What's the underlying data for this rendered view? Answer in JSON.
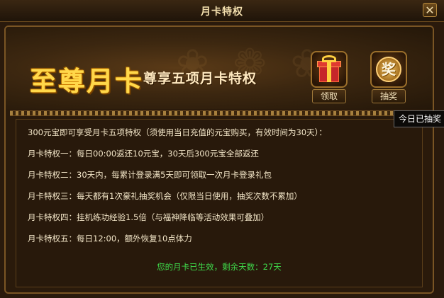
{
  "window": {
    "title": "月卡特权",
    "close_icon": "close-icon"
  },
  "banner": {
    "brand": "至尊月卡",
    "subtitle": "尊享五项月卡特权",
    "claim_label": "领取",
    "draw_label": "抽奖",
    "draw_icon_char": "奖"
  },
  "tooltip": "今日已抽奖",
  "content": {
    "lines": [
      "300元宝即可享受月卡五项特权（须使用当日充值的元宝购买，有效时间为30天）：",
      "月卡特权一：每日00:00返还10元宝，30天后300元宝全部返还",
      "月卡特权二：30天内，每累计登录满5天即可领取一次月卡登录礼包",
      "月卡特权三：每天都有1次豪礼抽奖机会（仅限当日使用，抽奖次数不累加）",
      "月卡特权四：挂机练功经验1.5倍（与福神降临等活动效果可叠加）",
      "月卡特权五：每日12:00，额外恢复10点体力"
    ],
    "status": "您的月卡已生效，剩余天数：27天"
  },
  "colors": {
    "accent_gold": "#ffd84a",
    "status_green": "#3fdc4b",
    "text": "#f3e6c8"
  }
}
